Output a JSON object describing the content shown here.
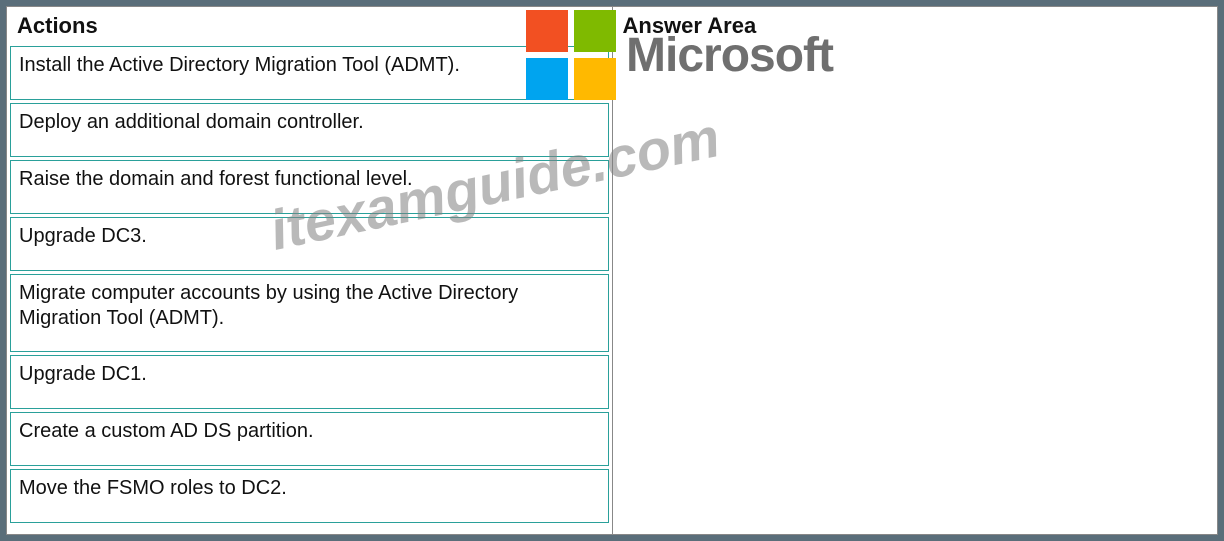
{
  "headers": {
    "actions": "Actions",
    "answer": "Answer Area"
  },
  "actions": [
    "Install the Active Directory Migration Tool (ADMT).",
    "Deploy an additional domain controller.",
    "Raise the domain and forest functional level.",
    "Upgrade DC3.",
    "Migrate computer accounts by using the Active Directory Migration Tool (ADMT).",
    "Upgrade DC1.",
    "Create a custom AD DS partition.",
    "Move the FSMO roles to DC2."
  ],
  "watermarks": {
    "ms": "Microsoft",
    "url": "itexamguide.com"
  }
}
